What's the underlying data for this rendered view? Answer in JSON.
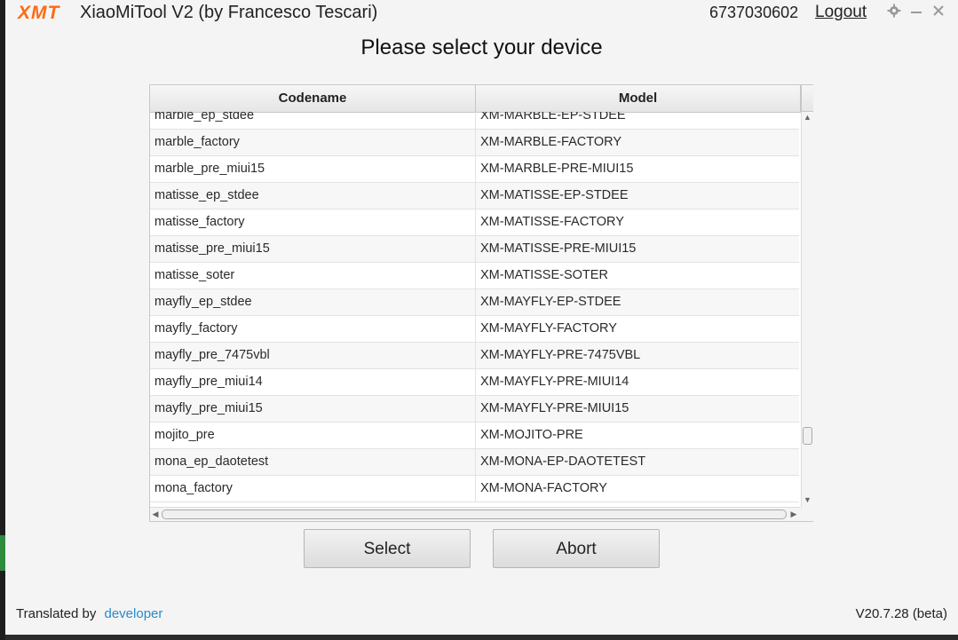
{
  "app": {
    "logo": "XMT",
    "title": "XiaoMiTool V2 (by Francesco Tescari)",
    "account_id": "6737030602",
    "logout_label": "Logout",
    "settings_icon": "gear-icon",
    "minimize_icon": "minimize-icon",
    "close_icon": "close-icon"
  },
  "heading": "Please select your device",
  "table": {
    "columns": [
      "Codename",
      "Model"
    ],
    "rows": [
      [
        "marble_ep_stdee",
        "XM-MARBLE-EP-STDEE"
      ],
      [
        "marble_factory",
        "XM-MARBLE-FACTORY"
      ],
      [
        "marble_pre_miui15",
        "XM-MARBLE-PRE-MIUI15"
      ],
      [
        "matisse_ep_stdee",
        "XM-MATISSE-EP-STDEE"
      ],
      [
        "matisse_factory",
        "XM-MATISSE-FACTORY"
      ],
      [
        "matisse_pre_miui15",
        "XM-MATISSE-PRE-MIUI15"
      ],
      [
        "matisse_soter",
        "XM-MATISSE-SOTER"
      ],
      [
        "mayfly_ep_stdee",
        "XM-MAYFLY-EP-STDEE"
      ],
      [
        "mayfly_factory",
        "XM-MAYFLY-FACTORY"
      ],
      [
        "mayfly_pre_7475vbl",
        "XM-MAYFLY-PRE-7475VBL"
      ],
      [
        "mayfly_pre_miui14",
        "XM-MAYFLY-PRE-MIUI14"
      ],
      [
        "mayfly_pre_miui15",
        "XM-MAYFLY-PRE-MIUI15"
      ],
      [
        "mojito_pre",
        "XM-MOJITO-PRE"
      ],
      [
        "mona_ep_daotetest",
        "XM-MONA-EP-DAOTETEST"
      ],
      [
        "mona_factory",
        "XM-MONA-FACTORY"
      ]
    ]
  },
  "buttons": {
    "select": "Select",
    "abort": "Abort"
  },
  "footer": {
    "translated_by": "Translated by",
    "developer_link": "developer",
    "version": "V20.7.28 (beta)"
  },
  "colors": {
    "logo": "#ff6a13",
    "link": "#2a8bc9",
    "window_bg": "#f4f4f4"
  }
}
